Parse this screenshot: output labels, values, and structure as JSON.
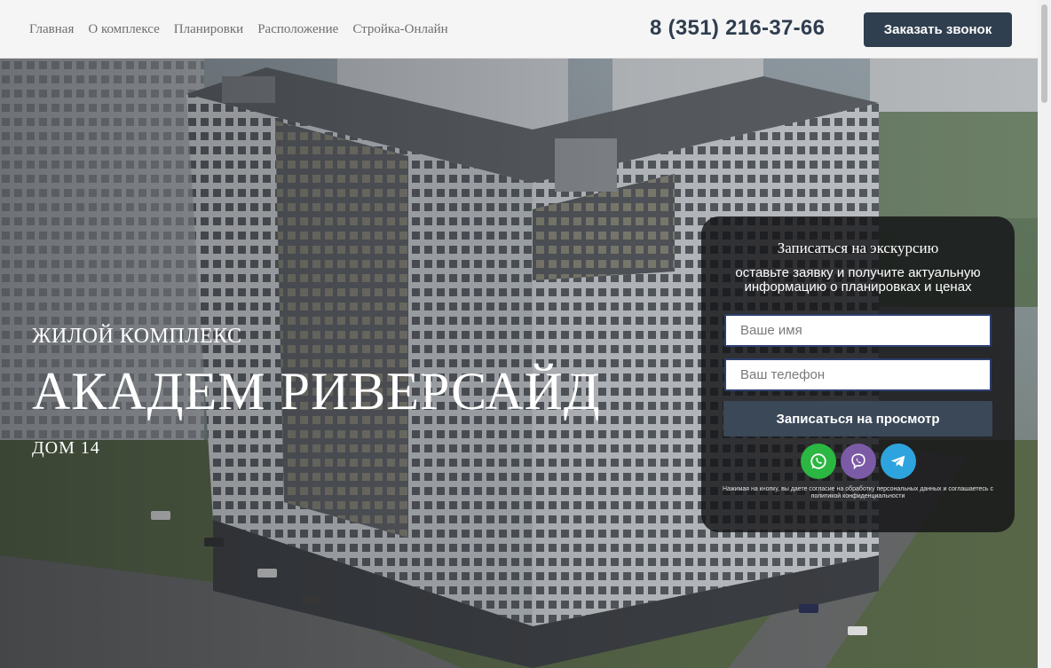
{
  "nav": {
    "items": [
      "Главная",
      "О комплексе",
      "Планировки",
      "Расположение",
      "Стройка-Онлайн"
    ]
  },
  "header": {
    "phone": "8 (351) 216-37-66",
    "call_button": "Заказать звонок"
  },
  "hero": {
    "subtitle": "ЖИЛОЙ КОМПЛЕКС",
    "title": "АКАДЕМ РИВЕРСАЙД",
    "house": "ДОМ 14"
  },
  "form": {
    "title": "Записаться на экскурсию",
    "description": "оставьте заявку и получите актуальную информацию о планировках и ценах",
    "name_placeholder": "Ваше имя",
    "phone_placeholder": "Ваш телефон",
    "submit_label": "Записаться на просмотр",
    "messengers": [
      "whatsapp-icon",
      "viber-icon",
      "telegram-icon"
    ],
    "consent": "Нажимая на кнопку, вы даете согласие на обработку персональных данных и соглашаетесь с политикой конфиденциальности"
  },
  "colors": {
    "brand_dark": "#2f3f4f",
    "whatsapp": "#2bb741",
    "viber": "#7b5aa6",
    "telegram": "#2ea4de"
  }
}
